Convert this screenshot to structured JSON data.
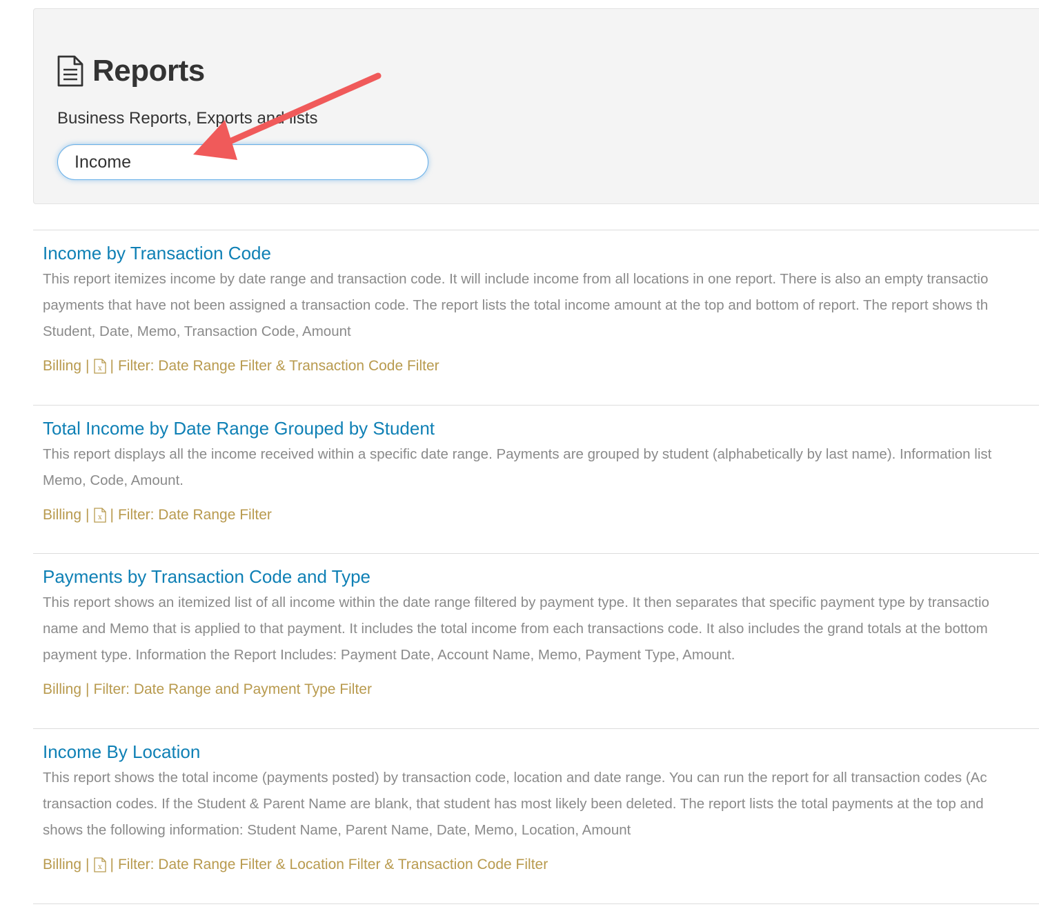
{
  "header": {
    "title": "Reports",
    "subtitle": "Business Reports, Exports and lists",
    "search_value": "Income",
    "icon": "document-icon"
  },
  "annotation": {
    "type": "arrow",
    "color": "#f05a5a",
    "icon": "red-arrow"
  },
  "reports": [
    {
      "title": "Income by Transaction Code",
      "description_lines": [
        "This report itemizes income by date range and transaction code. It will include income from all locations in one report. There is also an empty transactio",
        "payments that have not been assigned a transaction code. The report lists the total income amount at the top and bottom of report. The report shows th",
        "Student, Date, Memo, Transaction Code, Amount"
      ],
      "category": "Billing",
      "has_excel": true,
      "filter": "Filter: Date Range Filter & Transaction Code Filter"
    },
    {
      "title": "Total Income by Date Range Grouped by Student",
      "description_lines": [
        "This report displays all the income received within a specific date range. Payments are grouped by student (alphabetically by last name). Information list",
        "Memo, Code, Amount."
      ],
      "category": "Billing",
      "has_excel": true,
      "filter": "Filter: Date Range Filter"
    },
    {
      "title": "Payments by Transaction Code and Type",
      "description_lines": [
        "This report shows an itemized list of all income within the date range filtered by payment type. It then separates that specific payment type by transactio",
        "name and Memo that is applied to that payment. It includes the total income from each transactions code. It also includes the grand totals at the bottom",
        "payment type. Information the Report Includes: Payment Date, Account Name, Memo, Payment Type, Amount."
      ],
      "category": "Billing",
      "has_excel": false,
      "filter": "Filter: Date Range and Payment Type Filter"
    },
    {
      "title": "Income By Location",
      "description_lines": [
        "This report shows the total income (payments posted) by transaction code, location and date range. You can run the report for all transaction codes (Ac",
        "transaction codes. If the Student & Parent Name are blank, that student has most likely been deleted. The report lists the total payments at the top and",
        "shows the following information: Student Name, Parent Name, Date, Memo, Location, Amount"
      ],
      "category": "Billing",
      "has_excel": true,
      "filter": "Filter: Date Range Filter & Location Filter & Transaction Code Filter"
    }
  ],
  "colors": {
    "title_link": "#0f80b5",
    "description": "#8a8a8a",
    "meta": "#b89a4e",
    "panel_bg": "#f4f4f4"
  }
}
